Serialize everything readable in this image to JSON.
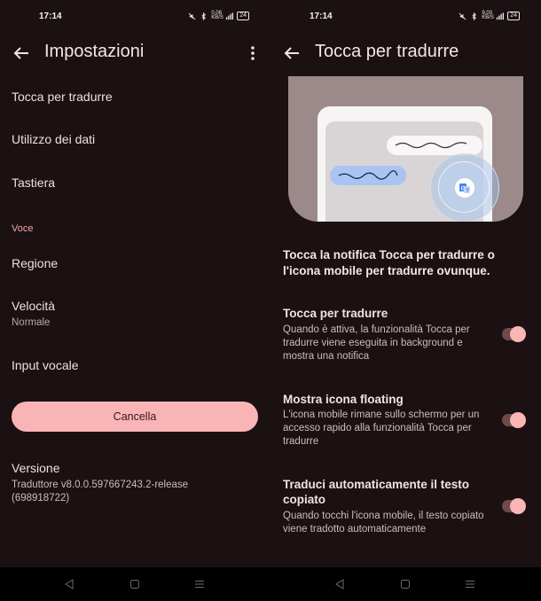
{
  "status_bar": {
    "time": "17:14",
    "left_speed": "0,06 KB/S",
    "right_speed": "9,00 KB/S",
    "battery": "24"
  },
  "left_screen": {
    "title": "Impostazioni",
    "items": [
      {
        "label": "Tocca per tradurre"
      },
      {
        "label": "Utilizzo dei dati"
      },
      {
        "label": "Tastiera"
      }
    ],
    "section_voice": "Voce",
    "voice_items": [
      {
        "label": "Regione",
        "sub": ""
      },
      {
        "label": "Velocità",
        "sub": "Normale"
      },
      {
        "label": "Input vocale",
        "sub": ""
      }
    ],
    "clear_button": "Cancella",
    "version_label": "Versione",
    "version_line1": "Traduttore v8.0.0.597667243.2-release",
    "version_line2": "(698918722)"
  },
  "right_screen": {
    "title": "Tocca per tradurre",
    "intro": "Tocca la notifica Tocca per tradurre o l'icona mobile per tradurre ovunque.",
    "toggles": [
      {
        "title": "Tocca per tradurre",
        "desc": "Quando è attiva, la funzionalità Tocca per tradurre viene eseguita in background e mostra una notifica",
        "on": true
      },
      {
        "title": "Mostra icona floating",
        "desc": "L'icona mobile rimane sullo schermo per un accesso rapido alla funzionalità Tocca per tradurre",
        "on": true
      },
      {
        "title": "Traduci automaticamente il testo copiato",
        "desc": "Quando tocchi l'icona mobile, il testo copiato viene tradotto automaticamente",
        "on": true
      }
    ]
  },
  "icons": {
    "back": "arrow-back-icon",
    "more": "more-vert-icon",
    "translate": "google-translate-icon",
    "nav_back": "triangle-back-icon",
    "nav_home": "square-home-icon",
    "nav_recents": "menu-recents-icon"
  },
  "colors": {
    "background": "#1b1112",
    "accent": "#f9b5b6",
    "section_header": "#f2a7ab",
    "toggle_track": "#6e4a4c"
  }
}
